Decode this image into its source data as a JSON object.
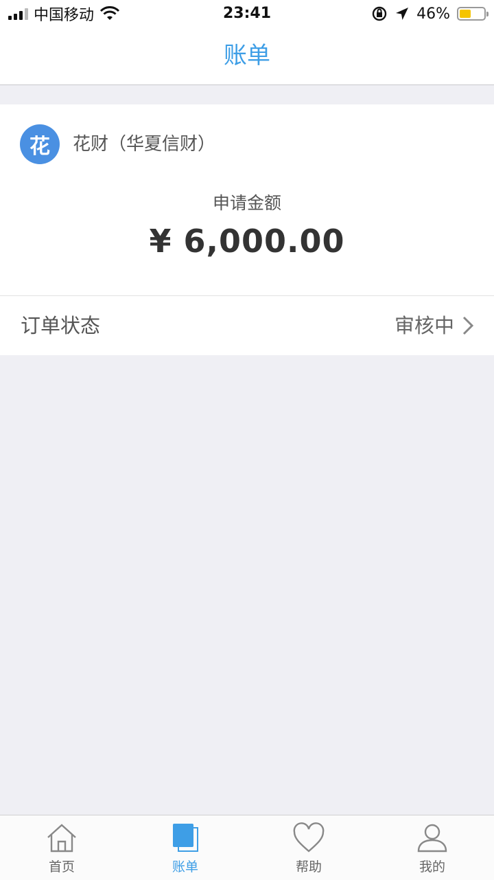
{
  "status_bar": {
    "carrier": "中国移动",
    "time": "23:41",
    "battery_percent": "46%",
    "battery_level": 0.46
  },
  "nav": {
    "title": "账单"
  },
  "loan": {
    "logo_char": "花",
    "lender": "花财（华夏信财）",
    "amount_label": "申请金额",
    "amount_value": "¥ 6,000.00"
  },
  "order": {
    "status_label": "订单状态",
    "status_value": "审核中"
  },
  "tabs": [
    {
      "label": "首页",
      "icon": "home-icon",
      "active": false
    },
    {
      "label": "账单",
      "icon": "bill-icon",
      "active": true
    },
    {
      "label": "帮助",
      "icon": "heart-icon",
      "active": false
    },
    {
      "label": "我的",
      "icon": "user-icon",
      "active": false
    }
  ],
  "colors": {
    "accent": "#3e9ee6",
    "logo": "#4a90e2",
    "background": "#efeff4"
  }
}
